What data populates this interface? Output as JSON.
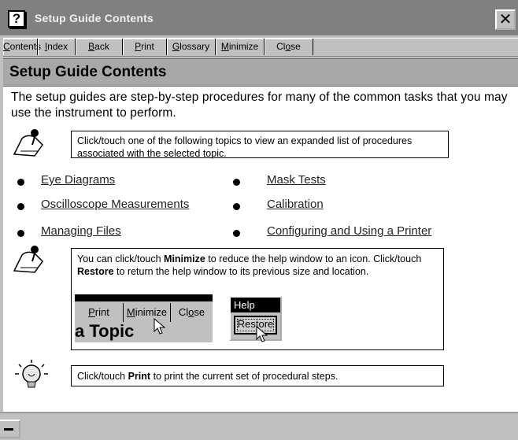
{
  "window": {
    "title": "Setup Guide Contents",
    "close_glyph": "✕"
  },
  "toolbar": {
    "buttons": [
      {
        "pre": "",
        "u": "C",
        "post": "ontents"
      },
      {
        "pre": "",
        "u": "I",
        "post": "ndex"
      },
      {
        "pre": "",
        "u": "B",
        "post": "ack"
      },
      {
        "pre": "",
        "u": "P",
        "post": "rint"
      },
      {
        "pre": "",
        "u": "G",
        "post": "lossary"
      },
      {
        "pre": "",
        "u": "M",
        "post": "inimize"
      },
      {
        "pre": "Cl",
        "u": "o",
        "post": "se"
      }
    ]
  },
  "page": {
    "heading": "Setup Guide Contents",
    "intro": "The setup guides are step-by-step procedures for many of the common tasks that you may use the instrument to perform.",
    "note1": "Click/touch one of the following topics to view an expanded list of procedures associated with the selected topic.",
    "topics_left": [
      "Eye Diagrams",
      "Oscilloscope Measurements",
      "Managing Files"
    ],
    "topics_right": [
      "Mask Tests",
      "Calibration",
      "Configuring and Using a Printer"
    ],
    "note2": {
      "a": "You can click/touch ",
      "b": "Minimize",
      "c": " to reduce the help window to an icon. Click/touch ",
      "d": "Restore",
      "e": " to return the help window to its previous size and location."
    },
    "illustration": {
      "buttons": [
        {
          "pre": "",
          "u": "P",
          "post": "rint"
        },
        {
          "pre": "",
          "u": "M",
          "post": "inimize"
        },
        {
          "pre": "Cl",
          "u": "o",
          "post": "se"
        }
      ],
      "fragment": "a Topic",
      "help_title": "Help",
      "restore_label": "Restore"
    },
    "note3": {
      "a": "Click/touch ",
      "b": "Print",
      "c": " to print the current set of procedural steps."
    }
  },
  "colors": {
    "titlebar": "#808080",
    "heading_band": "#a8a8a8",
    "content_bg": "#ffffff"
  }
}
